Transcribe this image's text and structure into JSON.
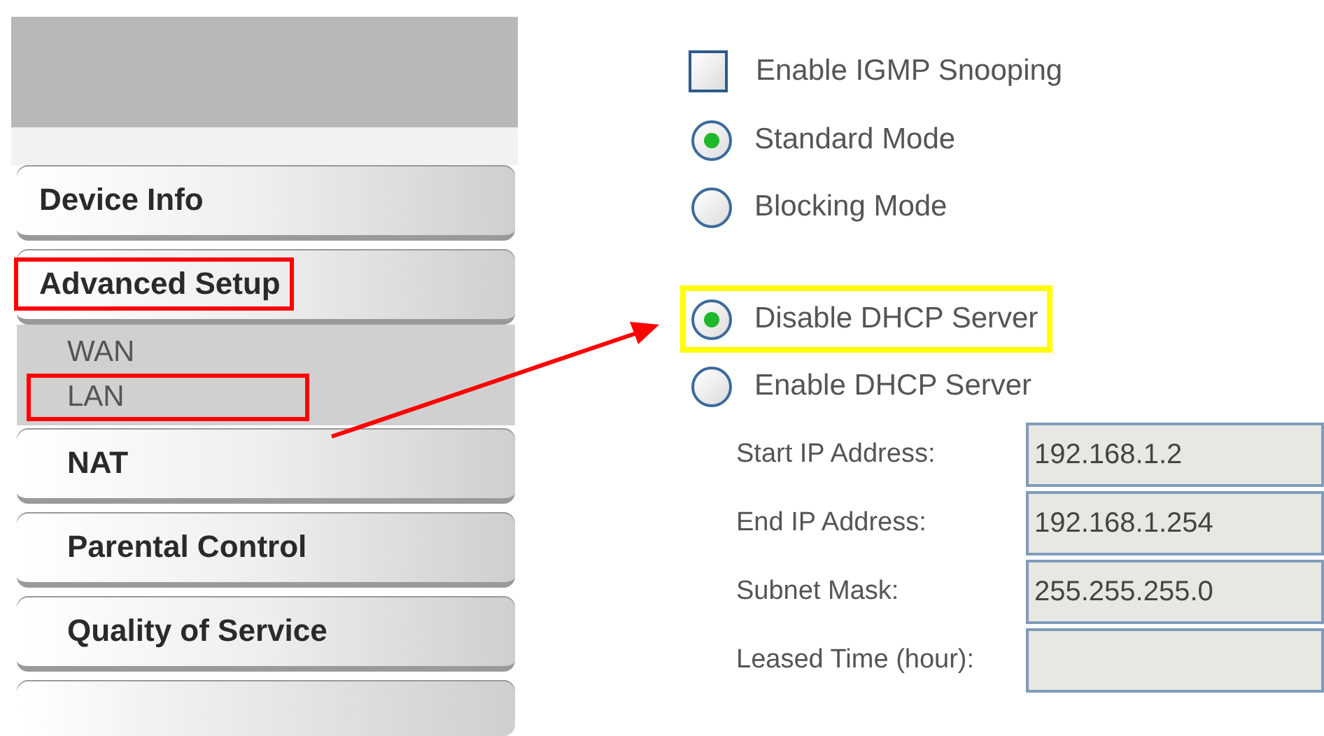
{
  "menu": [
    {
      "label": "Device Info",
      "highlighted": false
    },
    {
      "label": "Advanced Setup",
      "highlighted": true,
      "children": [
        {
          "label": "WAN",
          "highlighted": false
        },
        {
          "label": "LAN",
          "highlighted": true
        }
      ]
    },
    {
      "label": "NAT",
      "highlighted": false
    },
    {
      "label": "Parental Control",
      "highlighted": false
    },
    {
      "label": "Quality of Service",
      "highlighted": false
    }
  ],
  "igmp": {
    "checkbox": {
      "label": "Enable IGMP Snooping",
      "checked": false
    },
    "modes": [
      {
        "label": "Standard Mode",
        "selected": true,
        "highlighted": false
      },
      {
        "label": "Blocking Mode",
        "selected": false,
        "highlighted": false
      }
    ]
  },
  "dhcp": {
    "options": [
      {
        "label": "Disable DHCP Server",
        "selected": true,
        "highlighted": true
      },
      {
        "label": "Enable DHCP Server",
        "selected": false,
        "highlighted": false
      }
    ],
    "fields": [
      {
        "label": "Start IP Address:",
        "value": "192.168.1.2"
      },
      {
        "label": "End IP Address:",
        "value": "192.168.1.254"
      },
      {
        "label": "Subnet Mask:",
        "value": "255.255.255.0"
      },
      {
        "label": "Leased Time (hour):"
      }
    ]
  }
}
